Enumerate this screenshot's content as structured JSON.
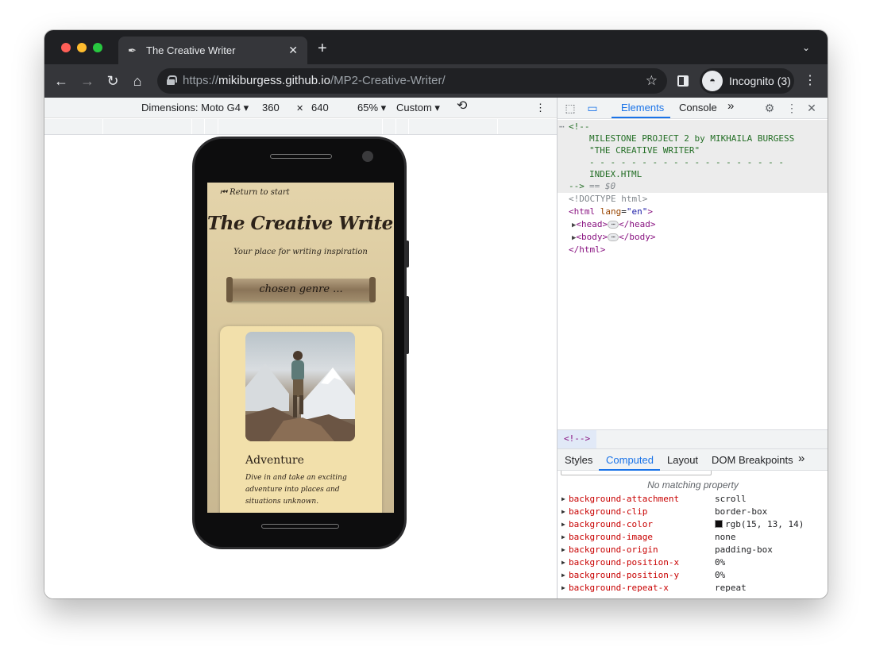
{
  "browser": {
    "tab_title": "The Creative Writer",
    "tab_close": "✕",
    "new_tab": "+",
    "url_prefix": "https://",
    "url_host": "mikiburgess.github.io",
    "url_path": "/MP2-Creative-Writer/",
    "incognito_label": "Incognito (3)"
  },
  "device_toolbar": {
    "dimensions": "Dimensions: Moto G4 ▾",
    "width": "360",
    "times": "✕",
    "height": "640",
    "zoom": "65% ▾",
    "throttle": "Custom ▾"
  },
  "site": {
    "return_link": "⏮ Return to start",
    "title": "The Creative Writer",
    "subtitle": "Your place for writing inspiration",
    "genre_banner": "chosen genre ...",
    "card_title": "Adventure",
    "card_text": "Dive in and take an exciting adventure into places and situations unknown."
  },
  "devtools": {
    "tabs": {
      "elements": "Elements",
      "console": "Console",
      "more": "»"
    },
    "dom": {
      "comment_open": "<!--",
      "comment_line1": "MILESTONE PROJECT 2 by MIKHAILA BURGESS",
      "comment_line2": "\"THE CREATIVE WRITER\"",
      "comment_line3": "- - - - - - - - - - - - - - - - - - -",
      "comment_line4": "INDEX.HTML",
      "comment_close": "-->",
      "selected_marker": "== $0",
      "doctype": "<!DOCTYPE html>",
      "html_open_tag": "<html",
      "html_attr_name": "lang",
      "html_attr_value": "\"en\"",
      "head_open": "<head>",
      "head_close": "</head>",
      "body_open": "<body>",
      "body_close": "</body>",
      "html_close": "</html>"
    },
    "breadcrumb": "<!-->",
    "panel_tabs": {
      "styles": "Styles",
      "computed": "Computed",
      "layout": "Layout",
      "dom_breakpoints": "DOM Breakpoints",
      "more": "»"
    },
    "no_match": "No matching property",
    "computed_props": [
      {
        "name": "background-attachment",
        "value": "scroll"
      },
      {
        "name": "background-clip",
        "value": "border-box"
      },
      {
        "name": "background-color",
        "value": "rgb(15, 13, 14)",
        "swatch": "#0f0d0e"
      },
      {
        "name": "background-image",
        "value": "none"
      },
      {
        "name": "background-origin",
        "value": "padding-box"
      },
      {
        "name": "background-position-x",
        "value": "0%"
      },
      {
        "name": "background-position-y",
        "value": "0%"
      },
      {
        "name": "background-repeat-x",
        "value": "repeat"
      }
    ]
  }
}
